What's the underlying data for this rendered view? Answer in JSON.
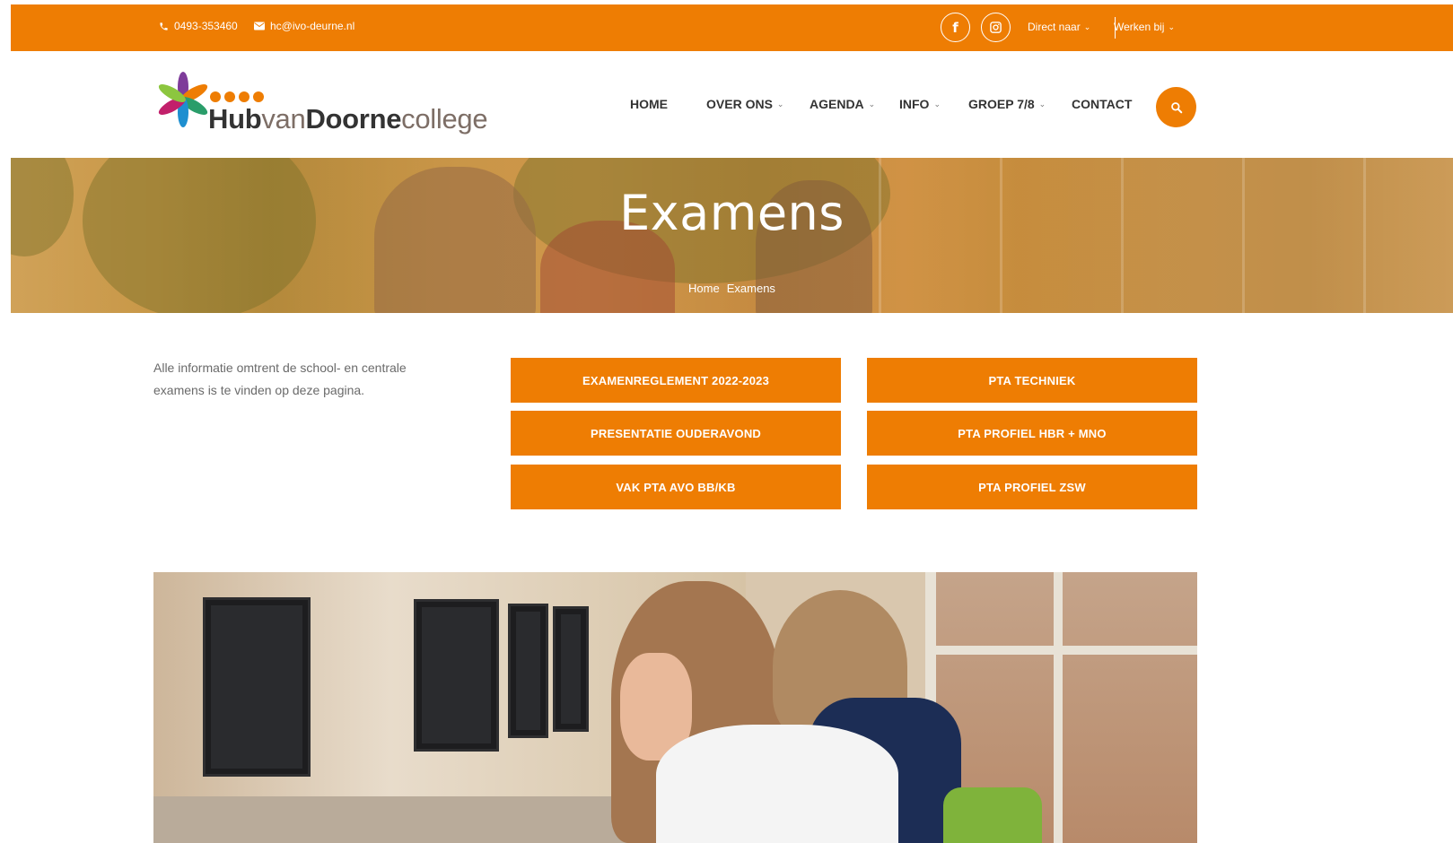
{
  "topbar": {
    "phone": "0493-353460",
    "email": "hc@ivo-deurne.nl",
    "direct_naar": "Direct naar",
    "werken_bij": "Werken bij"
  },
  "logo": {
    "part1": "Hub",
    "part2": "van",
    "part3": "Doorne",
    "part4": "college"
  },
  "nav": {
    "home": "HOME",
    "over_ons": "OVER ONS",
    "agenda": "AGENDA",
    "info": "INFO",
    "groep": "GROEP 7/8",
    "contact": "CONTACT"
  },
  "hero": {
    "title": "Examens",
    "crumb_home": "Home",
    "crumb_current": "Examens"
  },
  "intro": "Alle informatie omtrent de school- en centrale examens is te vinden op deze pagina.",
  "buttons": [
    "EXAMENREGLEMENT 2022-2023",
    "PTA TECHNIEK",
    "PRESENTATIE OUDERAVOND",
    "PTA PROFIEL HBR + MNO",
    "VAK PTA AVO BB/KB",
    "PTA PROFIEL ZSW"
  ],
  "colors": {
    "accent": "#ee7d03",
    "text": "#333333"
  },
  "icons": {
    "phone": "phone-icon",
    "email": "envelope-icon",
    "facebook": "facebook-icon",
    "instagram": "instagram-icon",
    "search": "search-icon",
    "chevron": "chevron-down-icon"
  }
}
